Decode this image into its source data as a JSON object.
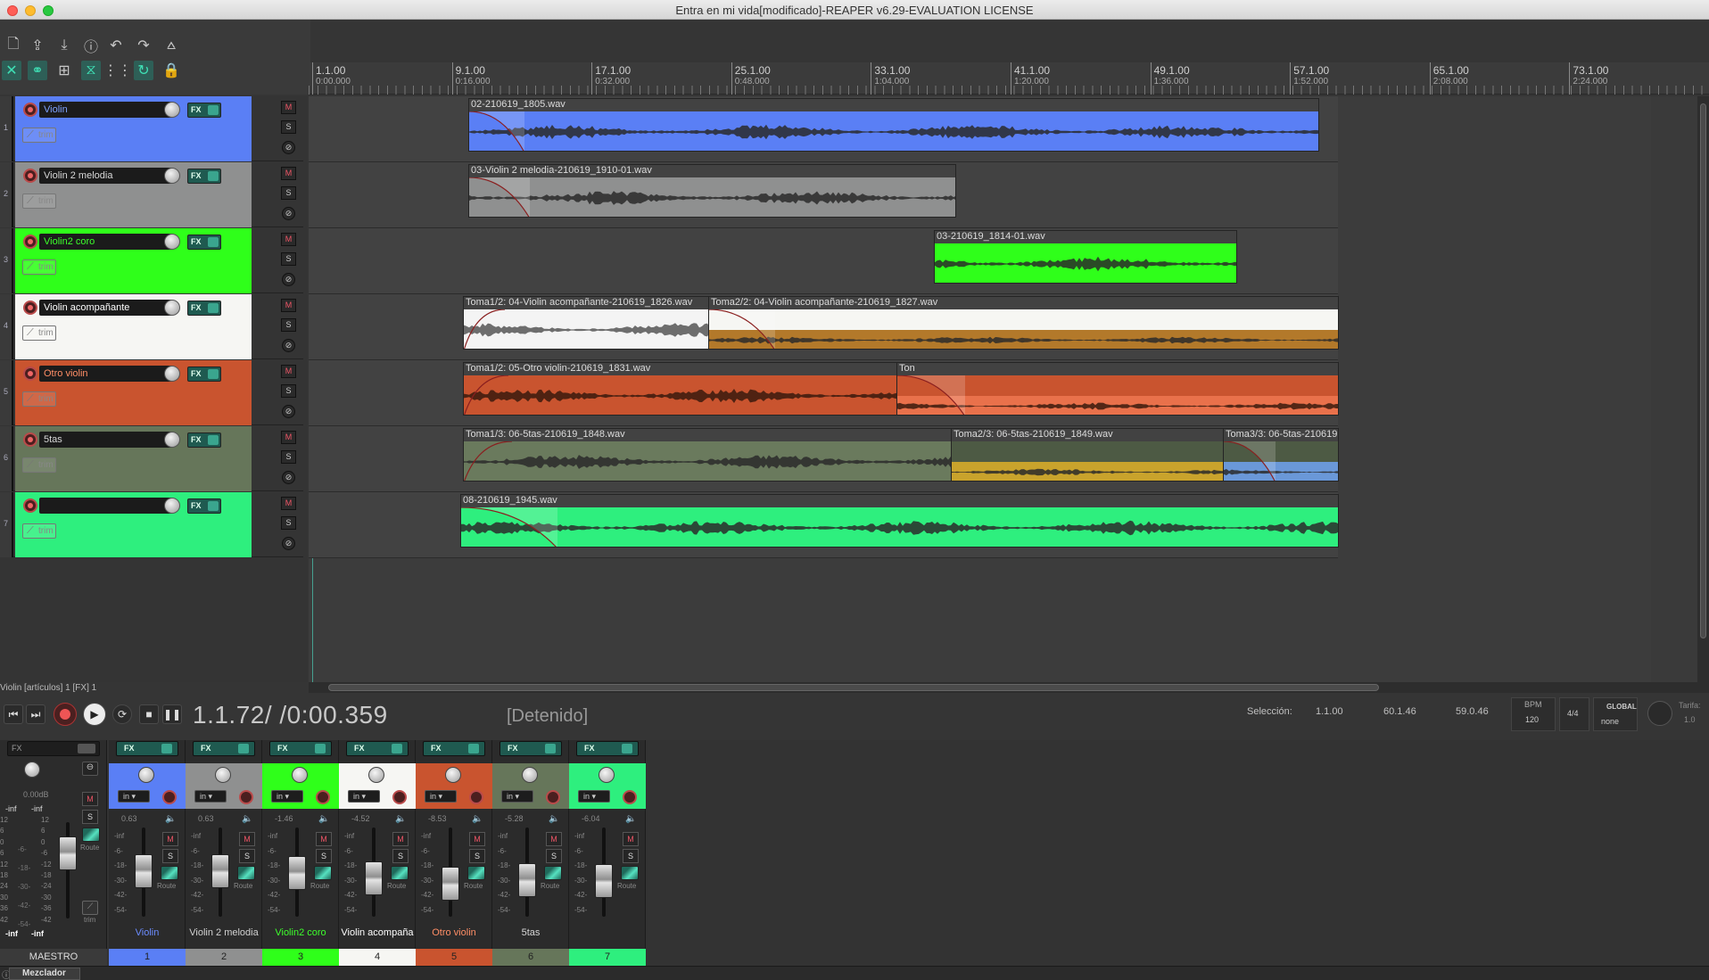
{
  "window": {
    "title": "Entra en mi vida[modificado]-REAPER v6.29-EVALUATION LICENSE"
  },
  "toolbar": {
    "row1": [
      "new-file-icon",
      "save-icon",
      "save-download-icon",
      "info-icon",
      "undo-icon",
      "redo-icon",
      "metronome-icon"
    ],
    "row2": [
      "ripple-edit-icon",
      "link-icon",
      "grid-icon",
      "auto-crossfade-icon",
      "snap-grid-icon",
      "loop-icon",
      "lock-icon"
    ]
  },
  "ruler": {
    "marks": [
      {
        "bar": "1.1.00",
        "time": "0:00.000"
      },
      {
        "bar": "9.1.00",
        "time": "0:16.000"
      },
      {
        "bar": "17.1.00",
        "time": "0:32.000"
      },
      {
        "bar": "25.1.00",
        "time": "0:48.000"
      },
      {
        "bar": "33.1.00",
        "time": "1:04.000"
      },
      {
        "bar": "41.1.00",
        "time": "1:20.000"
      },
      {
        "bar": "49.1.00",
        "time": "1:36.000"
      },
      {
        "bar": "57.1.00",
        "time": "1:52.000"
      },
      {
        "bar": "65.1.00",
        "time": "2:08.000"
      },
      {
        "bar": "73.1.00",
        "time": "2:24.000"
      }
    ]
  },
  "tracks": [
    {
      "num": "1",
      "name": "Violin",
      "color": "#5a7ff5",
      "text": "#ffffff",
      "name_color": "#7ea2ff"
    },
    {
      "num": "2",
      "name": "Violin 2 melodia",
      "color": "#8f9090",
      "text": "#e0e0e0",
      "name_color": "#d8d8d8"
    },
    {
      "num": "3",
      "name": "Violin2 coro",
      "color": "#2fff1a",
      "text": "#1b1b1b",
      "name_color": "#3dff2c"
    },
    {
      "num": "4",
      "name": "Violin acompañante",
      "color": "#f6f6f3",
      "text": "#ffffff",
      "name_color": "#ffffff"
    },
    {
      "num": "5",
      "name": "Otro violin",
      "color": "#c9542f",
      "text": "#ff8e66",
      "name_color": "#ff8e66"
    },
    {
      "num": "6",
      "name": "5tas",
      "color": "#66765a",
      "text": "#d6d6d6",
      "name_color": "#d6d6d6"
    },
    {
      "num": "7",
      "name": "",
      "color": "#2eef7e",
      "text": "#ffffff",
      "name_color": "#ffffff"
    }
  ],
  "track_controls": {
    "trim_label": "trim",
    "fx_label": "FX",
    "mute_label": "M",
    "solo_label": "S"
  },
  "items": {
    "t1": [
      "02-210619_1805.wav"
    ],
    "t2": [
      "03-Violin 2 melodia-210619_1910-01.wav"
    ],
    "t3": [
      "03-210619_1814-01.wav"
    ],
    "t4": [
      "Toma1/2: 04-Violin acompañante-210619_1826.wav",
      "Toma2/2: 04-Violin acompañante-210619_1827.wav"
    ],
    "t5": [
      "Toma1/2: 05-Otro violin-210619_1831.wav",
      "Ton"
    ],
    "t6": [
      "Toma1/3: 06-5tas-210619_1848.wav",
      "Toma2/3: 06-5tas-210619_1849.wav",
      "Toma3/3: 06-5tas-210619"
    ],
    "t7": [
      "08-210619_1945.wav"
    ]
  },
  "status": {
    "text": "Violin [artículos] 1 [FX] 1"
  },
  "transport": {
    "time": "1.1.72/ /0:00.359",
    "state": "[Detenido]",
    "selection_label": "Selección:",
    "sel_start": "1.1.00",
    "sel_end": "60.1.46",
    "sel_len": "59.0.46",
    "bpm_label": "BPM",
    "bpm": "120",
    "timesig": "4/4",
    "global_label": "GLOBAL",
    "global_value": "none",
    "rate_label": "Tarifa:",
    "rate_value": "1.0"
  },
  "mixer": {
    "master_label": "MAESTRO",
    "master_db": "0.00dB",
    "master_peak_l": "-inf",
    "master_peak_r": "-inf",
    "master_bottom_l": "-inf",
    "master_bottom_r": "-inf",
    "master_fx": "FX",
    "route_label": "Route",
    "trim_label": "trim",
    "in_label": "in",
    "scale": [
      "-inf",
      "-6-",
      "-18-",
      "-30-",
      "-42-",
      "-54-"
    ],
    "master_scale": [
      "12",
      "6",
      "0",
      "6",
      "12",
      "18",
      "24",
      "30",
      "36",
      "42"
    ],
    "master_scale2": [
      "12",
      "6",
      "0",
      "-6",
      "-12",
      "-18",
      "-24",
      "-30",
      "-36",
      "-42"
    ],
    "master_scale_mid": [
      "-6-",
      "-18-",
      "-30-",
      "-42-",
      "-54-"
    ],
    "strips": [
      {
        "num": "1",
        "name": "Violin",
        "db": "0.63",
        "color": "#5a7ff5",
        "name_color": "#6b8cff",
        "fader": 0.6
      },
      {
        "num": "2",
        "name": "Violin 2 melodia",
        "db": "0.63",
        "color": "#8f9090",
        "name_color": "#d0d0d0",
        "fader": 0.6
      },
      {
        "num": "3",
        "name": "Violin2 coro",
        "db": "-1.46",
        "color": "#2fff1a",
        "name_color": "#3dff2c",
        "fader": 0.58
      },
      {
        "num": "4",
        "name": "Violin acompaña",
        "db": "-4.52",
        "color": "#f6f6f3",
        "name_color": "#ffffff",
        "fader": 0.52
      },
      {
        "num": "5",
        "name": "Otro violin",
        "db": "-8.53",
        "color": "#c9542f",
        "name_color": "#ff8e66",
        "fader": 0.46
      },
      {
        "num": "6",
        "name": "5tas",
        "db": "-5.28",
        "color": "#66765a",
        "name_color": "#d6d6d6",
        "fader": 0.5
      },
      {
        "num": "7",
        "name": "",
        "db": "-6.04",
        "color": "#2eef7e",
        "name_color": "#ffffff",
        "fader": 0.49
      }
    ]
  },
  "bottom": {
    "tab": "Mezclador"
  }
}
